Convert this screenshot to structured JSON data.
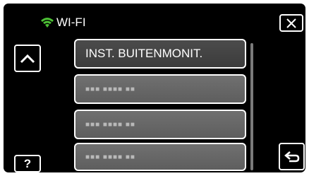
{
  "header": {
    "title": "WI-FI",
    "wifi_icon_color": "#4cc035"
  },
  "buttons": {
    "close_icon": "close-icon",
    "up_icon": "chevron-up-icon",
    "help_label": "?",
    "back_icon": "return-arrow-icon"
  },
  "list": {
    "items": [
      {
        "label": "INST. BUITENMONIT.",
        "selected": true
      },
      {
        "label": "■■■ ■■■■ ■■",
        "masked": true
      },
      {
        "label": "■■■ ■■■■ ■■",
        "masked": true
      },
      {
        "label": "■■■ ■■■■ ■■",
        "masked": true
      }
    ]
  }
}
